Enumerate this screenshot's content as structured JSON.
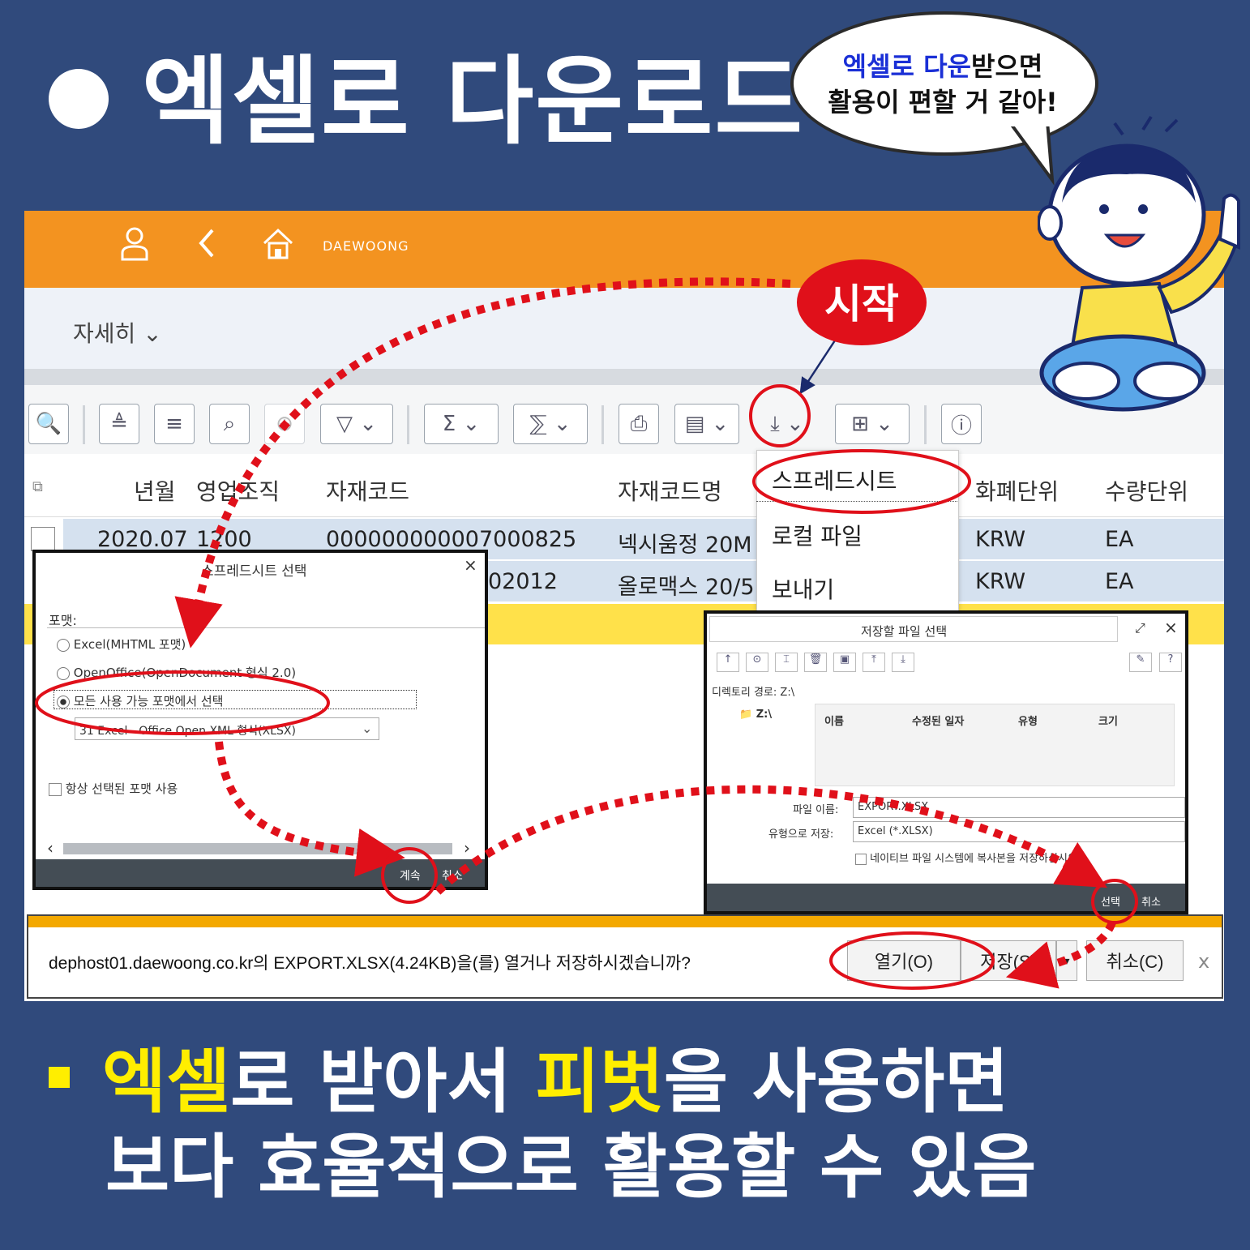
{
  "title": "엑셀로 다운로드",
  "bubble": {
    "part1": "엑셀로 다운",
    "part2": "받으면",
    "line2": "활용이 편할 거 같아!"
  },
  "start_label": "시작",
  "app": {
    "logo": "DAEWOONG",
    "detail": "자세히",
    "columns": [
      "년월",
      "영업조직",
      "자재코드",
      "자재코드명",
      "화폐단위",
      "수량단위"
    ],
    "rows": [
      {
        "ym": "2020.07",
        "org": "1200",
        "code": "000000000007000825",
        "name": "넥시움정 20M",
        "cur": "KRW",
        "unit": "EA"
      },
      {
        "ym": "",
        "org": "",
        "code": "02012",
        "name": "올로맥스 20/5",
        "cur": "KRW",
        "unit": "EA"
      }
    ],
    "export_menu": [
      "스프레드시트",
      "로컬 파일",
      "보내기"
    ]
  },
  "dialog_spreadsheet": {
    "title": "스프레드시트 선택",
    "format_label": "포맷:",
    "options": [
      "Excel(MHTML 포맷)",
      "OpenOffice(OpenDocument 형식 2.0)",
      "모든 사용 가능 포맷에서 선택"
    ],
    "selected_format": "31 Excel - Office Open XML 형식(XLSX)",
    "always_use": "항상 선택된 포맷 사용",
    "continue": "계속",
    "cancel": "취소"
  },
  "dialog_save": {
    "title": "저장할 파일 선택",
    "dir_label": "디렉토리 경로:",
    "dir_value": "Z:\\",
    "tree_item": "Z:\\",
    "cols": [
      "이름",
      "수정된 일자",
      "유형",
      "크기"
    ],
    "filename_label": "파일 이름:",
    "filename": "EXPORT.XLSX",
    "type_label": "유형으로 저장:",
    "type_value": "Excel (*.XLSX)",
    "copy_label": "네이티브 파일 시스템에 복사본을 저장하십시오.",
    "select": "선택",
    "cancel": "취소"
  },
  "download_bar": {
    "message": "dephost01.daewoong.co.kr의 EXPORT.XLSX(4.24KB)을(를) 열거나 저장하시겠습니까?",
    "open": "열기(O)",
    "save": "저장(S)",
    "cancel": "취소(C)",
    "close": "x"
  },
  "bottom": {
    "l1a": "엑셀",
    "l1b": "로 받아서 ",
    "l1c": "피벗",
    "l1d": "을 사용하면",
    "l2": "보다 효율적으로 활용할 수 있음"
  },
  "colors": {
    "background": "#304a7c",
    "orange": "#f39320",
    "highlight": "#ffee00",
    "red": "#e0101a"
  }
}
